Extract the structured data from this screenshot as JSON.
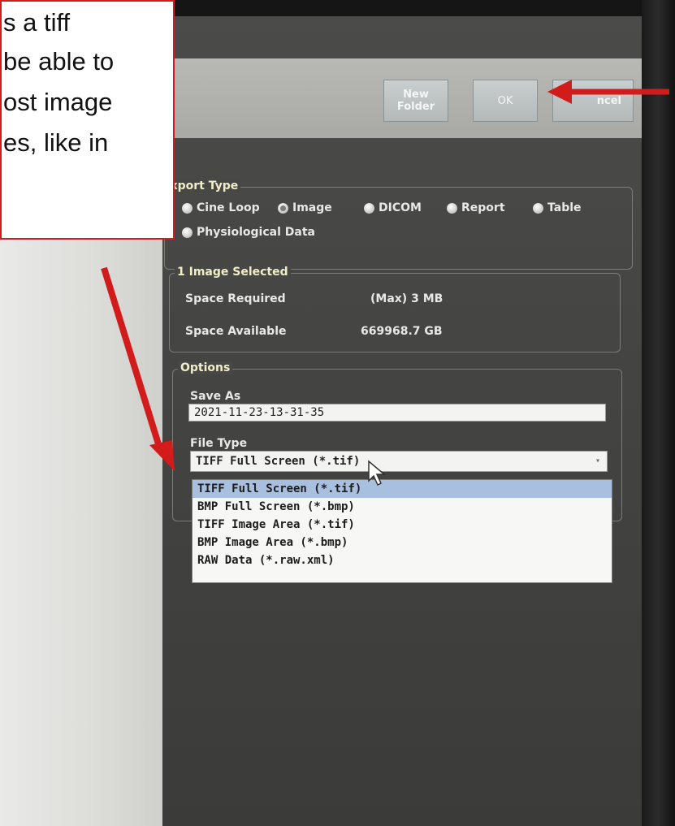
{
  "toolbar": {
    "new_folder_label": "New\nFolder",
    "ok_label": "OK",
    "cancel_label": "ncel"
  },
  "export_type": {
    "title": "Export Type",
    "options": [
      "Cine Loop",
      "Image",
      "DICOM",
      "Report",
      "Table",
      "Physiological Data"
    ],
    "selected": "Image"
  },
  "selection": {
    "title": "1 Image Selected",
    "space_required_label": "Space Required",
    "space_required_value": "(Max) 3 MB",
    "space_available_label": "Space Available",
    "space_available_value": "669968.7 GB"
  },
  "options": {
    "title": "Options",
    "save_as_label": "Save As",
    "save_as_value": "2021-11-23-13-31-35",
    "file_type_label": "File Type",
    "file_type_selected": "TIFF Full Screen (*.tif)",
    "file_type_options": [
      "TIFF Full Screen (*.tif)",
      "BMP Full Screen (*.bmp)",
      "TIFF Image Area (*.tif)",
      "BMP Image Area (*.bmp)",
      "RAW Data (*.raw.xml)"
    ]
  },
  "callout": {
    "lines": [
      "s a tiff",
      "be able to",
      "ost image",
      "es, like in"
    ]
  },
  "colors": {
    "arrow": "#d21b1b",
    "highlight": "#a9bfdf",
    "legend_text": "#f1eec9"
  }
}
